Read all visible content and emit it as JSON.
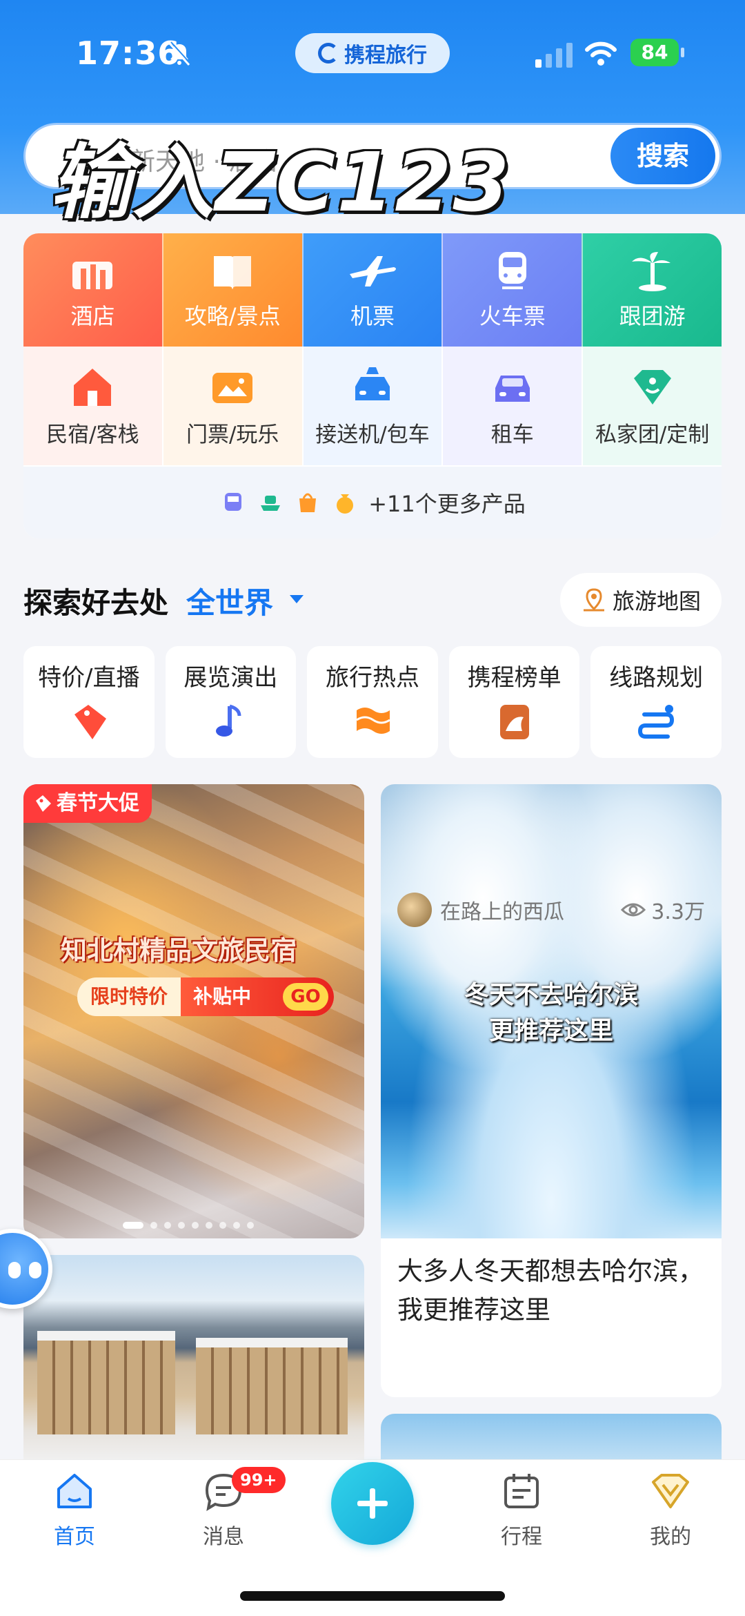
{
  "status_bar": {
    "time": "17:36",
    "battery": "84"
  },
  "brand": {
    "name": "携程旅行"
  },
  "search": {
    "placeholder": "冰雪新天地 · 酒店",
    "button": "搜索",
    "overlay_caption": "输入ZC123"
  },
  "services_top": [
    {
      "label": "酒店",
      "icon": "hotel-icon"
    },
    {
      "label": "攻略/景点",
      "icon": "book-icon"
    },
    {
      "label": "机票",
      "icon": "airplane-icon"
    },
    {
      "label": "火车票",
      "icon": "train-icon"
    },
    {
      "label": "跟团游",
      "icon": "palm-icon"
    }
  ],
  "services_mid": [
    {
      "label": "民宿/客栈",
      "icon": "house-icon"
    },
    {
      "label": "门票/玩乐",
      "icon": "ticket-icon"
    },
    {
      "label": "接送机/包车",
      "icon": "taxi-icon"
    },
    {
      "label": "租车",
      "icon": "car-icon"
    },
    {
      "label": "私家团/定制",
      "icon": "diamond-icon"
    }
  ],
  "more_products": {
    "label": "+11个更多产品"
  },
  "explore": {
    "title": "探索好去处",
    "region": "全世界",
    "map_button": "旅游地图"
  },
  "categories": [
    {
      "label": "特价/直播",
      "icon": "price-tag-icon"
    },
    {
      "label": "展览演出",
      "icon": "music-note-icon"
    },
    {
      "label": "旅行热点",
      "icon": "hot-flag-icon"
    },
    {
      "label": "携程榜单",
      "icon": "rank-badge-icon"
    },
    {
      "label": "线路规划",
      "icon": "route-icon"
    }
  ],
  "feed": {
    "promo": {
      "tag": "春节大促",
      "title": "知北村精品文旅民宿",
      "deal_left": "限时特价",
      "deal_right": "补贴中",
      "go": "GO"
    },
    "snow": {
      "caption_line1": "冬天不去哈尔滨",
      "caption_line2": "更推荐这里",
      "title": "大多人冬天都想去哈尔滨，我更推荐这里",
      "author": "在路上的西瓜",
      "views": "3.3万"
    }
  },
  "tabs": {
    "home": "首页",
    "messages": "消息",
    "trips": "行程",
    "me": "我的",
    "badge": "99+"
  },
  "colors": {
    "brand_blue": "#1677f2",
    "badge_red": "#ff2a2a",
    "plus_cyan": "#1fb9e0"
  }
}
